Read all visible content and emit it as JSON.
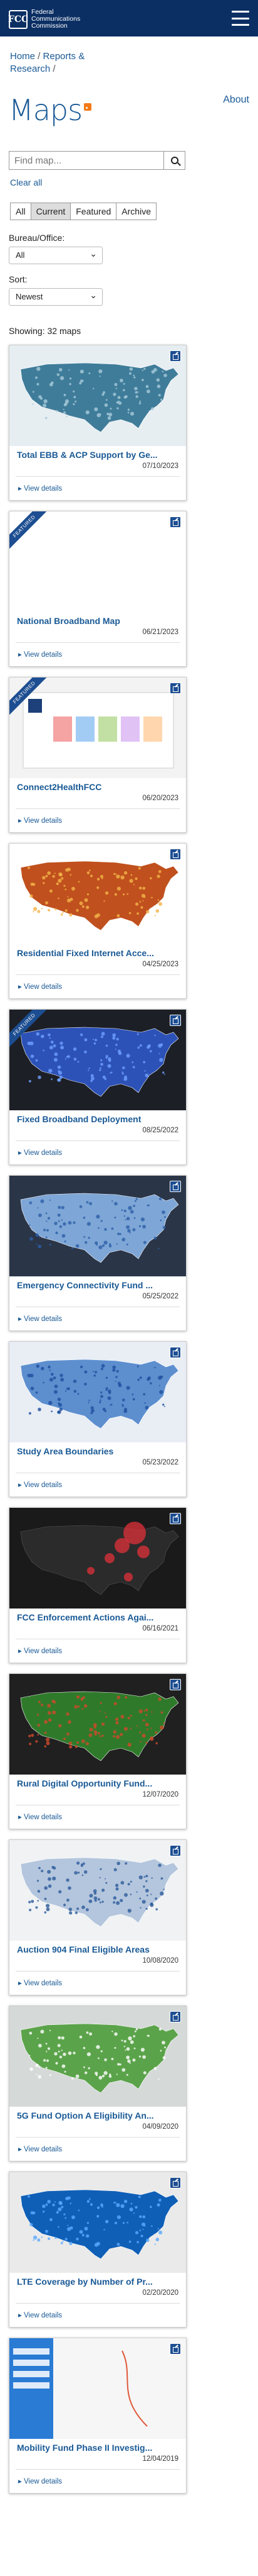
{
  "header": {
    "logo_mark": "FCC",
    "logo_line1": "Federal",
    "logo_line2": "Communications",
    "logo_line3": "Commission"
  },
  "breadcrumb": {
    "home": "Home",
    "reports": "Reports &",
    "research": "Research"
  },
  "page": {
    "title": "Maps",
    "about": "About"
  },
  "search": {
    "placeholder": "Find map...",
    "clear": "Clear all"
  },
  "tabs": [
    "All",
    "Current",
    "Featured",
    "Archive"
  ],
  "filters": {
    "bureau_label": "Bureau/Office:",
    "bureau_value": "All",
    "sort_label": "Sort:",
    "sort_value": "Newest"
  },
  "showing": "Showing: 32 maps",
  "view_details": "View details",
  "featured_label": "FEATURED",
  "cards": [
    {
      "title": "Total EBB & ACP Support by Ge...",
      "date": "07/10/2023",
      "featured": false,
      "thumb": "us-choropleth-teal"
    },
    {
      "title": "National Broadband Map",
      "date": "06/21/2023",
      "featured": true,
      "thumb": "blank"
    },
    {
      "title": "Connect2HealthFCC",
      "date": "06/20/2023",
      "featured": true,
      "thumb": "report"
    },
    {
      "title": "Residential Fixed Internet Acce...",
      "date": "04/25/2023",
      "featured": false,
      "thumb": "us-heat-red"
    },
    {
      "title": "Fixed Broadband Deployment",
      "date": "08/25/2022",
      "featured": true,
      "thumb": "us-dark-blue"
    },
    {
      "title": "Emergency Connectivity Fund ...",
      "date": "05/25/2022",
      "featured": false,
      "thumb": "us-blue-states"
    },
    {
      "title": "Study Area Boundaries",
      "date": "05/23/2022",
      "featured": false,
      "thumb": "us-blue-dots"
    },
    {
      "title": "FCC Enforcement Actions Agai...",
      "date": "06/16/2021",
      "featured": false,
      "thumb": "dark-red-circles"
    },
    {
      "title": "Rural Digital Opportunity Fund...",
      "date": "12/07/2020",
      "featured": false,
      "thumb": "us-green-dark"
    },
    {
      "title": "Auction 904 Final Eligible Areas",
      "date": "10/08/2020",
      "featured": false,
      "thumb": "us-dots-light"
    },
    {
      "title": "5G Fund Option A Eligibility An...",
      "date": "04/09/2020",
      "featured": false,
      "thumb": "us-green-white"
    },
    {
      "title": "LTE Coverage by Number of Pr...",
      "date": "02/20/2020",
      "featured": false,
      "thumb": "us-blue-lte"
    },
    {
      "title": "Mobility Fund Phase II Investig...",
      "date": "12/04/2019",
      "featured": false,
      "thumb": "light-map"
    }
  ]
}
